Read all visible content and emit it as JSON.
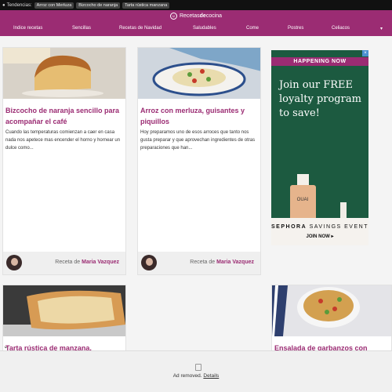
{
  "trending": {
    "label": "Tendencias:",
    "chips": [
      "Arroz con Merluza",
      "Bizcocho de naranja",
      "Tarta rústica manzana"
    ]
  },
  "header": {
    "logo_prefix": "Recetas",
    "logo_bold": "de",
    "logo_suffix": "cocina",
    "brand_color": "#9b2c73"
  },
  "nav": [
    "Indice recetas",
    "Sencillas",
    "Recetas de Navidad",
    "Saludables",
    "Come",
    "Postres",
    "Celiacos"
  ],
  "cards": [
    {
      "title": "Bizcocho de naranja sencillo para acompañar el café",
      "desc": "Cuando las temperaturas comienzan a caer en casa nada nos apetece mas encender el horno y hornear un dulce como...",
      "byline": "Receta de",
      "author": "Maria Vazquez"
    },
    {
      "title": "Arroz con merluza, guisantes y piquillos",
      "desc": "Hoy preparamos uno de esos arroces que tanto nos gusta preparar y que aprovechan ingredientes de otras preparaciones que han...",
      "byline": "Receta de",
      "author": "Maria Vazquez"
    },
    {
      "title": "Tarta rústica de manzana,",
      "desc": "",
      "byline": "",
      "author": ""
    },
    {
      "title": "Ensalada de garbanzos con",
      "desc": "",
      "byline": "",
      "author": ""
    }
  ],
  "ad": {
    "banner": "HAPPENING NOW",
    "headline": "Join our FREE loyalty program to save!",
    "bottle_label": "OUAI",
    "brand": "SEPHORA",
    "event": "SAVINGS EVENT",
    "cta": "JOIN NOW ▸"
  },
  "ad_removed": {
    "message": "Ad removed.",
    "link": "Details"
  }
}
